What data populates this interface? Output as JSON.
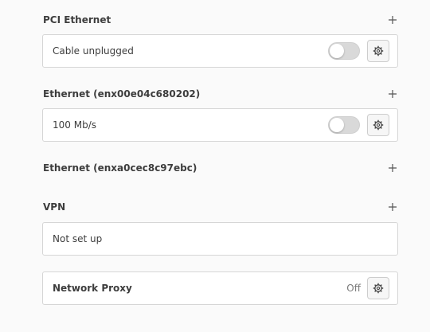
{
  "sections": [
    {
      "title": "PCI Ethernet",
      "row_label": "Cable unplugged"
    },
    {
      "title": "Ethernet (enx00e04c680202)",
      "row_label": "100 Mb/s"
    },
    {
      "title": "Ethernet (enxa0cec8c97ebc)"
    },
    {
      "title": "VPN",
      "row_label": "Not set up"
    }
  ],
  "proxy": {
    "label": "Network Proxy",
    "status": "Off"
  },
  "icons": {
    "add": "plus-icon",
    "settings": "gear-icon"
  }
}
